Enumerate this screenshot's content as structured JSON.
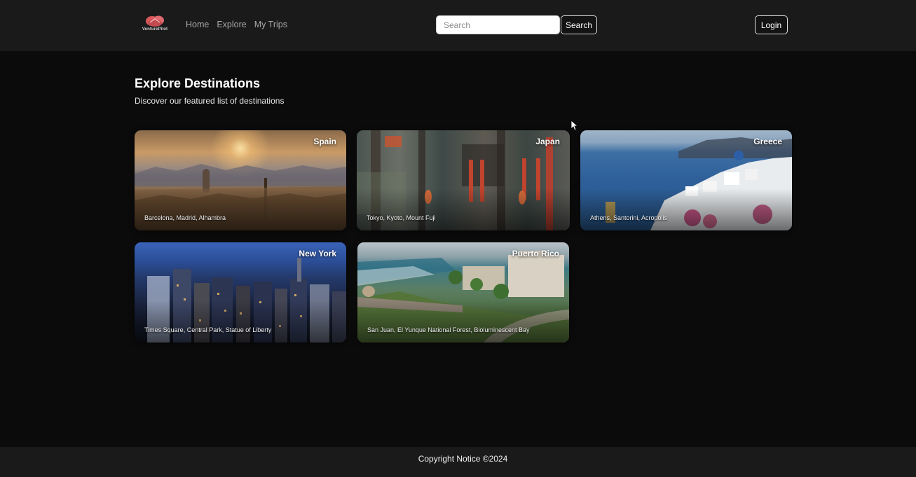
{
  "header": {
    "logo_text": "VenturePilot",
    "nav": [
      {
        "label": "Home"
      },
      {
        "label": "Explore"
      },
      {
        "label": "My Trips"
      }
    ],
    "search": {
      "placeholder": "Search",
      "value": "",
      "button_label": "Search"
    },
    "login_label": "Login"
  },
  "main": {
    "title": "Explore Destinations",
    "subtitle": "Discover our featured list of destinations",
    "destinations": [
      {
        "name": "Spain",
        "places": "Barcelona, Madrid, Alhambra"
      },
      {
        "name": "Japan",
        "places": "Tokyo, Kyoto, Mount Fuji"
      },
      {
        "name": "Greece",
        "places": "Athens, Santorini, Acropolis"
      },
      {
        "name": "New York",
        "places": "Times Square, Central Park, Statue of Liberty"
      },
      {
        "name": "Puerto Rico",
        "places": "San Juan, El Yunque National Forest, Bioluminescent Bay"
      }
    ]
  },
  "footer": {
    "text": "Copyright Notice ©2024"
  },
  "colors": {
    "page_bg": "#0b0b0c",
    "bar_bg": "#1a1a1b",
    "logo_accent": "#d9575b"
  },
  "icons": {
    "logo": "venturepilot-logo-icon",
    "cursor": "mouse-pointer-icon"
  }
}
